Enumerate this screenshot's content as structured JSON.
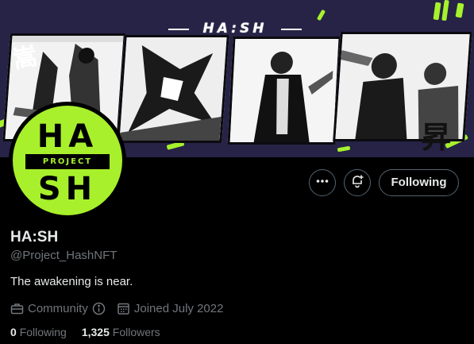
{
  "banner": {
    "title": "HA:SH",
    "kanji_left": "嵩",
    "kanji_right": "昇",
    "accent_color": "#a6f22c",
    "background_color": "#262347"
  },
  "avatar": {
    "line1": "HA",
    "band": "PROJECT",
    "line2": "SH",
    "color": "#a8f02b"
  },
  "actions": {
    "more_icon": "more-horizontal-icon",
    "notify_icon": "bell-plus-icon",
    "following_label": "Following"
  },
  "profile": {
    "name": "HA:SH",
    "handle": "@Project_HashNFT",
    "bio": "The awakening is near.",
    "category": "Community",
    "category_icon": "briefcase-icon",
    "info_icon": "info-icon",
    "joined": "Joined July 2022",
    "joined_icon": "calendar-icon"
  },
  "stats": {
    "following_count": "0",
    "following_label": "Following",
    "followers_count": "1,325",
    "followers_label": "Followers"
  }
}
